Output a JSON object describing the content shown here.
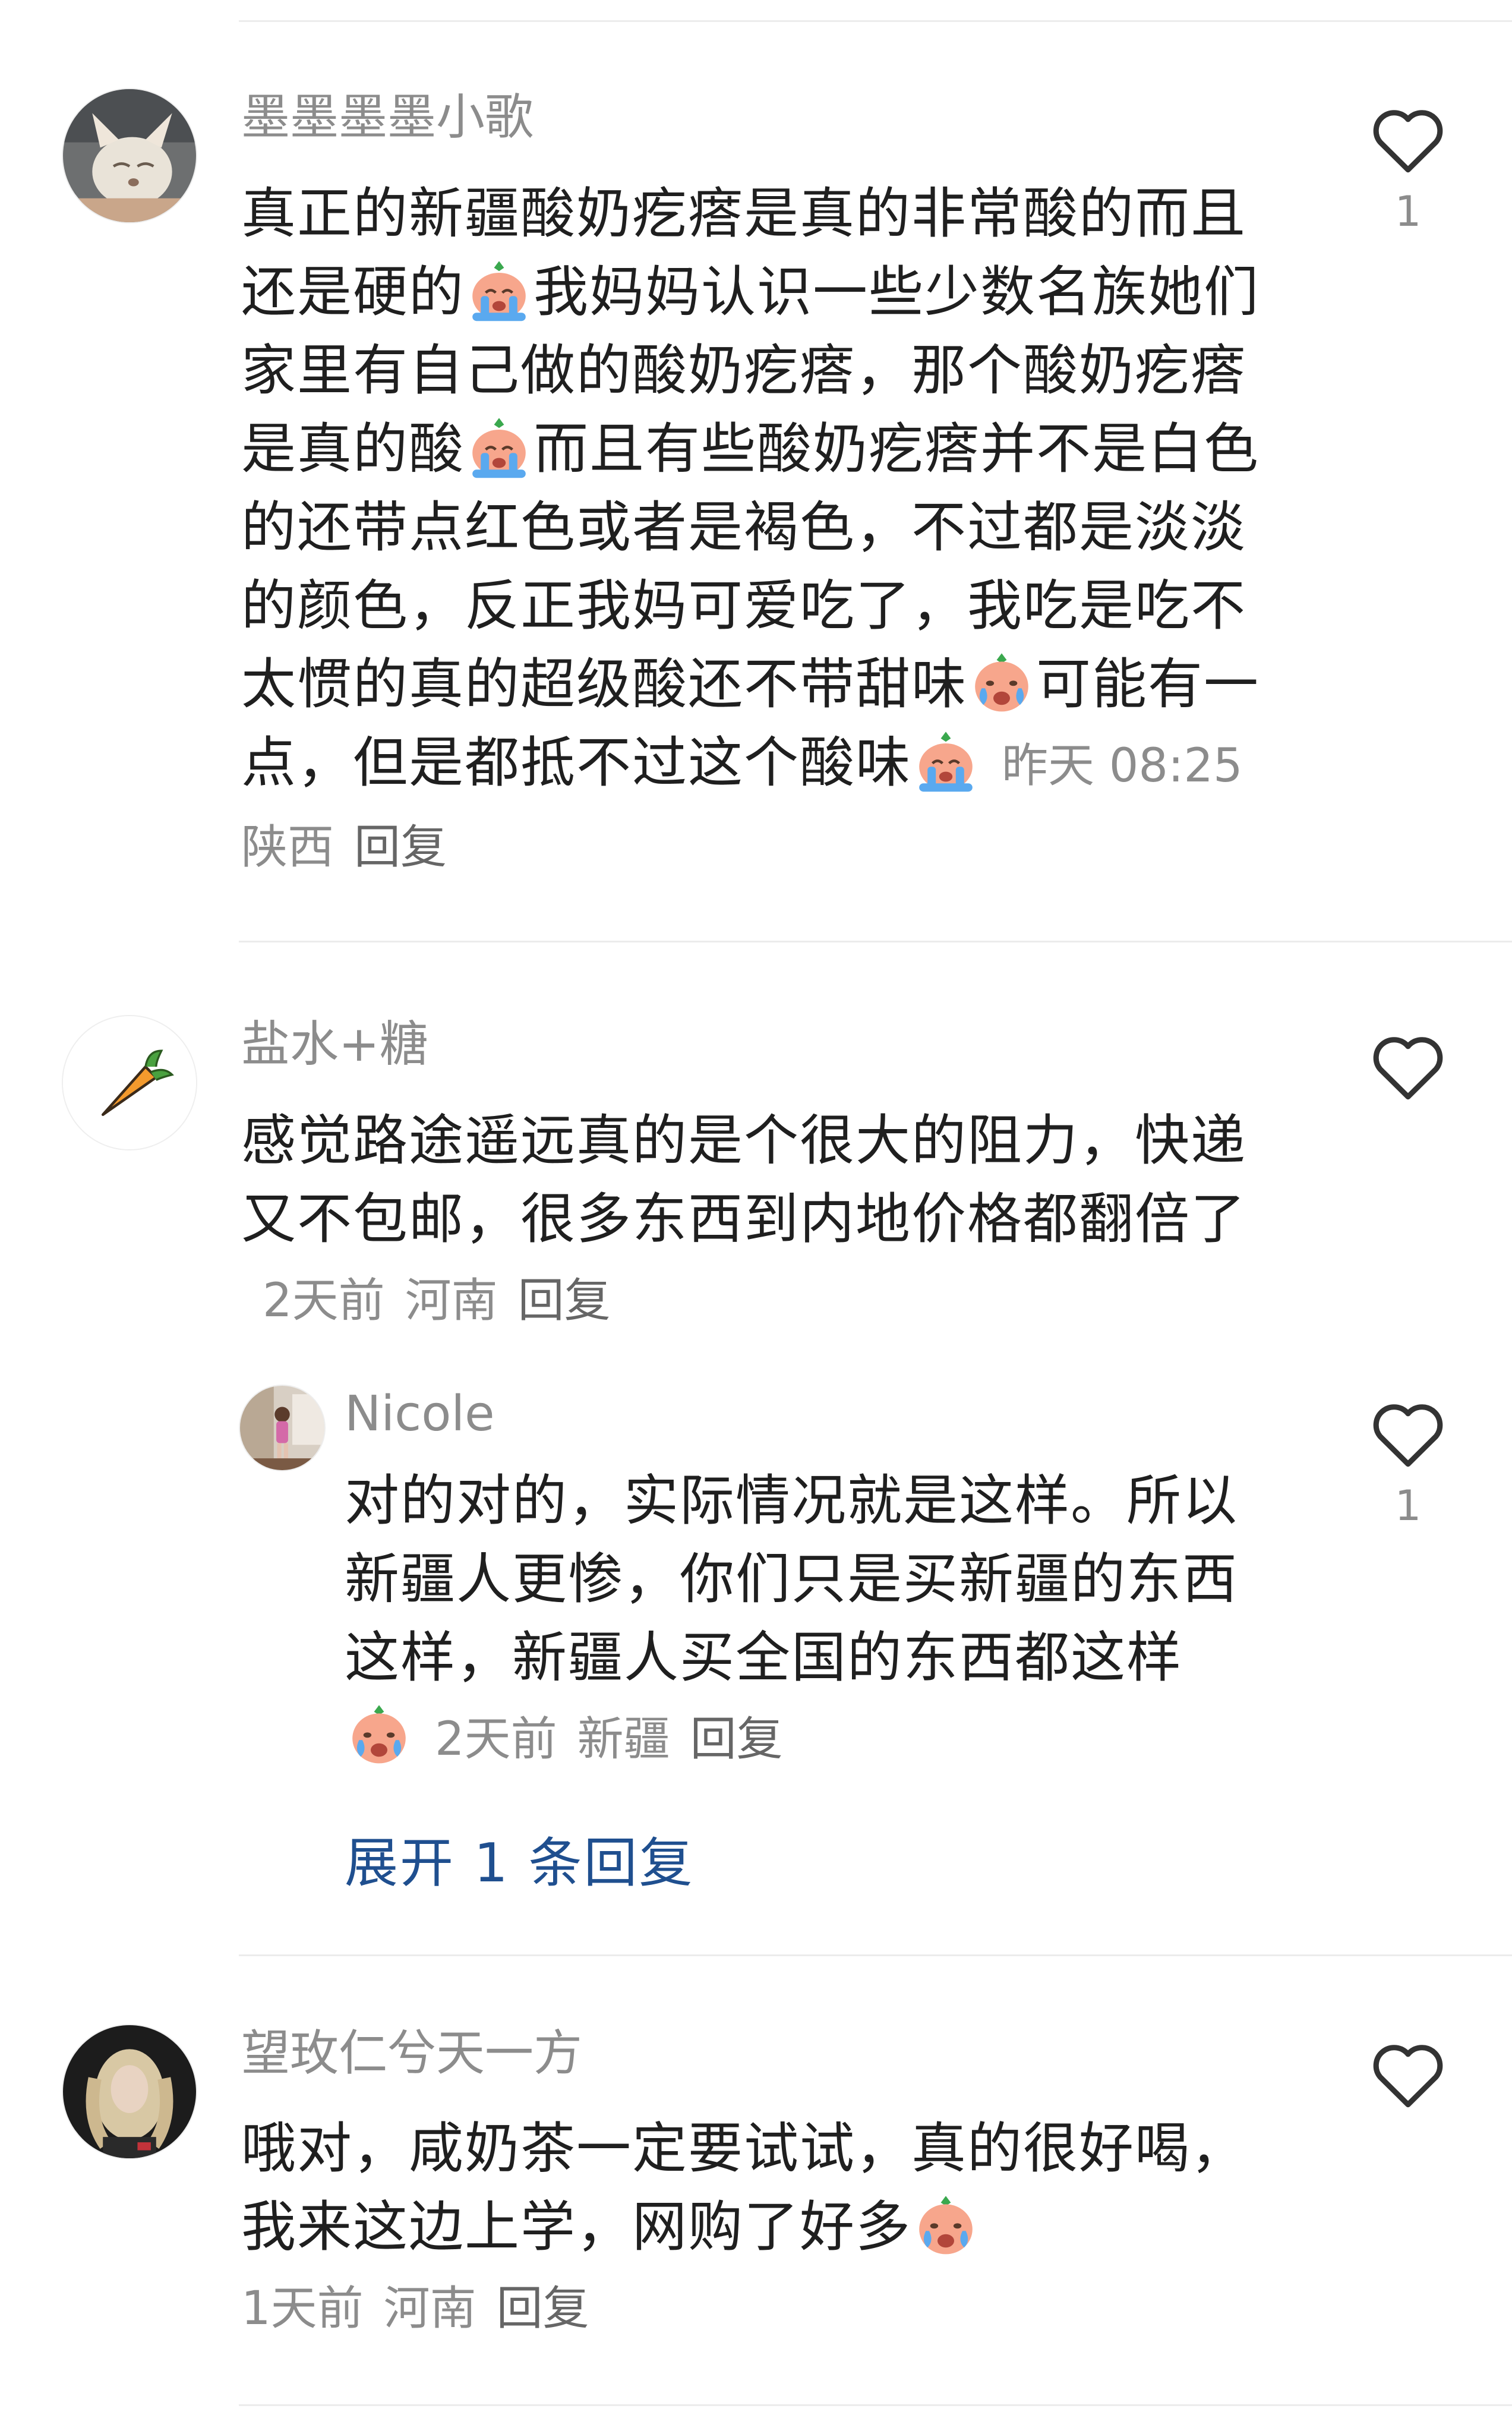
{
  "comments": [
    {
      "username": "墨墨墨墨小歌",
      "content_parts": [
        "真正的新疆酸奶疙瘩是真的非常酸的而且还是硬的",
        "我妈妈认识一些少数名族她们家里有自己做的酸奶疙瘩，那个酸奶疙瘩是真的酸",
        "而且有些酸奶疙瘩并不是白色的还带点红色或者是褐色，不过都是淡淡的颜色，反正我妈可爱吃了，我吃是吃不太惯的真的超级酸还不带甜味",
        "可能有一点，但是都抵不过这个酸味"
      ],
      "time": "昨天 08:25",
      "location": "陕西",
      "reply_label": "回复",
      "likes": "1",
      "avatar_icon": "fox-avatar"
    },
    {
      "username": "盐水+糖",
      "content": "感觉路途遥远真的是个很大的阻力，快递又不包邮，很多东西到内地价格都翻倍了",
      "time": "2天前",
      "location": "河南",
      "reply_label": "回复",
      "likes": "",
      "avatar_icon": "carrot-avatar",
      "replies": [
        {
          "username": "Nicole",
          "content": "对的对的，实际情况就是这样。所以新疆人更惨，你们只是买新疆的东西这样，新疆人买全国的东西都这样",
          "time": "2天前",
          "location": "新疆",
          "reply_label": "回复",
          "likes": "1",
          "avatar_icon": "girl-photo-avatar"
        }
      ],
      "expand_label": "展开 1 条回复"
    },
    {
      "username": "望玫仁兮天一方",
      "content": "哦对，咸奶茶一定要试试，真的很好喝，我来这边上学，网购了好多",
      "time": "1天前",
      "location": "河南",
      "reply_label": "回复",
      "likes": "",
      "avatar_icon": "blonde-person-avatar"
    }
  ],
  "icons": {
    "like": "heart-outline-icon",
    "emoji_cry": "crying-face-emoji",
    "emoji_tears": "tears-face-emoji"
  },
  "colors": {
    "username": "#8c8c8c",
    "text": "#1f1f1f",
    "link": "#1f4f8f",
    "divider": "#ececec"
  }
}
